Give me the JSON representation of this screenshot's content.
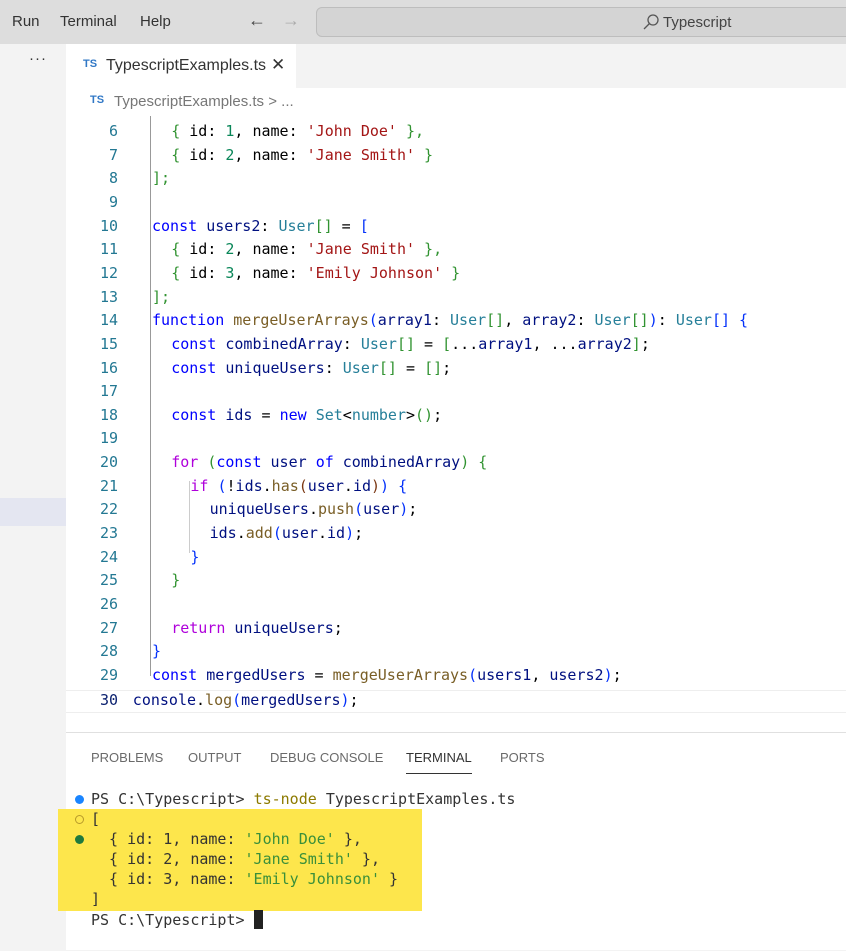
{
  "titlebar": {
    "menu": [
      "Run",
      "Terminal",
      "Help"
    ],
    "back_icon": "arrow-left-icon",
    "forward_icon": "arrow-right-icon",
    "search_label": "Typescript"
  },
  "sidebar": {
    "more_label": "···"
  },
  "tabs": [
    {
      "badge": "TS",
      "label": "TypescriptExamples.ts",
      "close": "✕",
      "active": true
    }
  ],
  "breadcrumb": {
    "badge": "TS",
    "file": "TypescriptExamples.ts",
    "rest": "> ..."
  },
  "editor": {
    "active_line": 30,
    "lines": [
      {
        "n": "6"
      },
      {
        "n": "7"
      },
      {
        "n": "8"
      },
      {
        "n": "9"
      },
      {
        "n": "10"
      },
      {
        "n": "11"
      },
      {
        "n": "12"
      },
      {
        "n": "13"
      },
      {
        "n": "14"
      },
      {
        "n": "15"
      },
      {
        "n": "16"
      },
      {
        "n": "17"
      },
      {
        "n": "18"
      },
      {
        "n": "19"
      },
      {
        "n": "20"
      },
      {
        "n": "21"
      },
      {
        "n": "22"
      },
      {
        "n": "23"
      },
      {
        "n": "24"
      },
      {
        "n": "25"
      },
      {
        "n": "26"
      },
      {
        "n": "27"
      },
      {
        "n": "28"
      },
      {
        "n": "29"
      },
      {
        "n": "30"
      }
    ],
    "code": {
      "l6": [
        "{ ",
        "id",
        ": ",
        "1",
        ", ",
        "name",
        ": ",
        "'John Doe'",
        " },"
      ],
      "l7": [
        "{ ",
        "id",
        ": ",
        "2",
        ", ",
        "name",
        ": ",
        "'Jane Smith'",
        " }"
      ],
      "l8": "];",
      "l10": [
        "const",
        " ",
        "users2",
        ": ",
        "User",
        "[]",
        " = ",
        "["
      ],
      "l11": [
        "{ ",
        "id",
        ": ",
        "2",
        ", ",
        "name",
        ": ",
        "'Jane Smith'",
        " },"
      ],
      "l12": [
        "{ ",
        "id",
        ": ",
        "3",
        ", ",
        "name",
        ": ",
        "'Emily Johnson'",
        " }"
      ],
      "l13": "];",
      "l14": [
        "function",
        " ",
        "mergeUserArrays",
        "(",
        "array1",
        ": ",
        "User",
        "[]",
        ", ",
        "array2",
        ": ",
        "User",
        "[]",
        ")",
        ": ",
        "User",
        "[]",
        " ",
        "{"
      ],
      "l15": [
        "const",
        " ",
        "combinedArray",
        ": ",
        "User",
        "[]",
        " = ",
        "[",
        "...",
        "array1",
        ", ...",
        "array2",
        "]",
        ";"
      ],
      "l16": [
        "const",
        " ",
        "uniqueUsers",
        ": ",
        "User",
        "[]",
        " = ",
        "[]",
        ";"
      ],
      "l18": [
        "const",
        " ",
        "ids",
        " = ",
        "new",
        " ",
        "Set",
        "<",
        "number",
        ">",
        "()",
        ";"
      ],
      "l20": [
        "for",
        " ",
        "(",
        "const",
        " ",
        "user",
        " ",
        "of",
        " ",
        "combinedArray",
        ")",
        " ",
        "{"
      ],
      "l21": [
        "if",
        " ",
        "(",
        "!",
        "ids",
        ".",
        "has",
        "(",
        "user",
        ".",
        "id",
        ")",
        ")",
        " ",
        "{"
      ],
      "l22": [
        "uniqueUsers",
        ".",
        "push",
        "(",
        "user",
        ")",
        ";"
      ],
      "l23": [
        "ids",
        ".",
        "add",
        "(",
        "user",
        ".",
        "id",
        ")",
        ";"
      ],
      "l24": "}",
      "l25": "}",
      "l27": [
        "return",
        " ",
        "uniqueUsers",
        ";"
      ],
      "l28": "}",
      "l29": [
        "const",
        " ",
        "mergedUsers",
        " = ",
        "mergeUserArrays",
        "(",
        "users1",
        ", ",
        "users2",
        ")",
        ";"
      ],
      "l30": [
        "console",
        ".",
        "log",
        "(",
        "mergedUsers",
        ")",
        ";"
      ]
    }
  },
  "panel": {
    "tabs": [
      "PROBLEMS",
      "OUTPUT",
      "DEBUG CONSOLE",
      "TERMINAL",
      "PORTS"
    ],
    "active_tab": "TERMINAL",
    "terminal": {
      "prompt": "PS C:\\Typescript>",
      "command": "ts-node",
      "command_arg": "TypescriptExamples.ts",
      "output_open": "[",
      "output_rows": [
        {
          "id": "1",
          "name": "'John Doe'",
          "trail": " },"
        },
        {
          "id": "2",
          "name": "'Jane Smith'",
          "trail": " },"
        },
        {
          "id": "3",
          "name": "'Emily Johnson'",
          "trail": " }"
        }
      ],
      "output_close": "]",
      "highlight_color": "#fde64c"
    }
  },
  "colors": {
    "keyword": "#0000ff",
    "control": "#af00db",
    "type": "#267f99",
    "string": "#a31515",
    "number": "#098658",
    "function": "#795e26",
    "variable": "#001080",
    "ts_badge": "#3178c6"
  }
}
